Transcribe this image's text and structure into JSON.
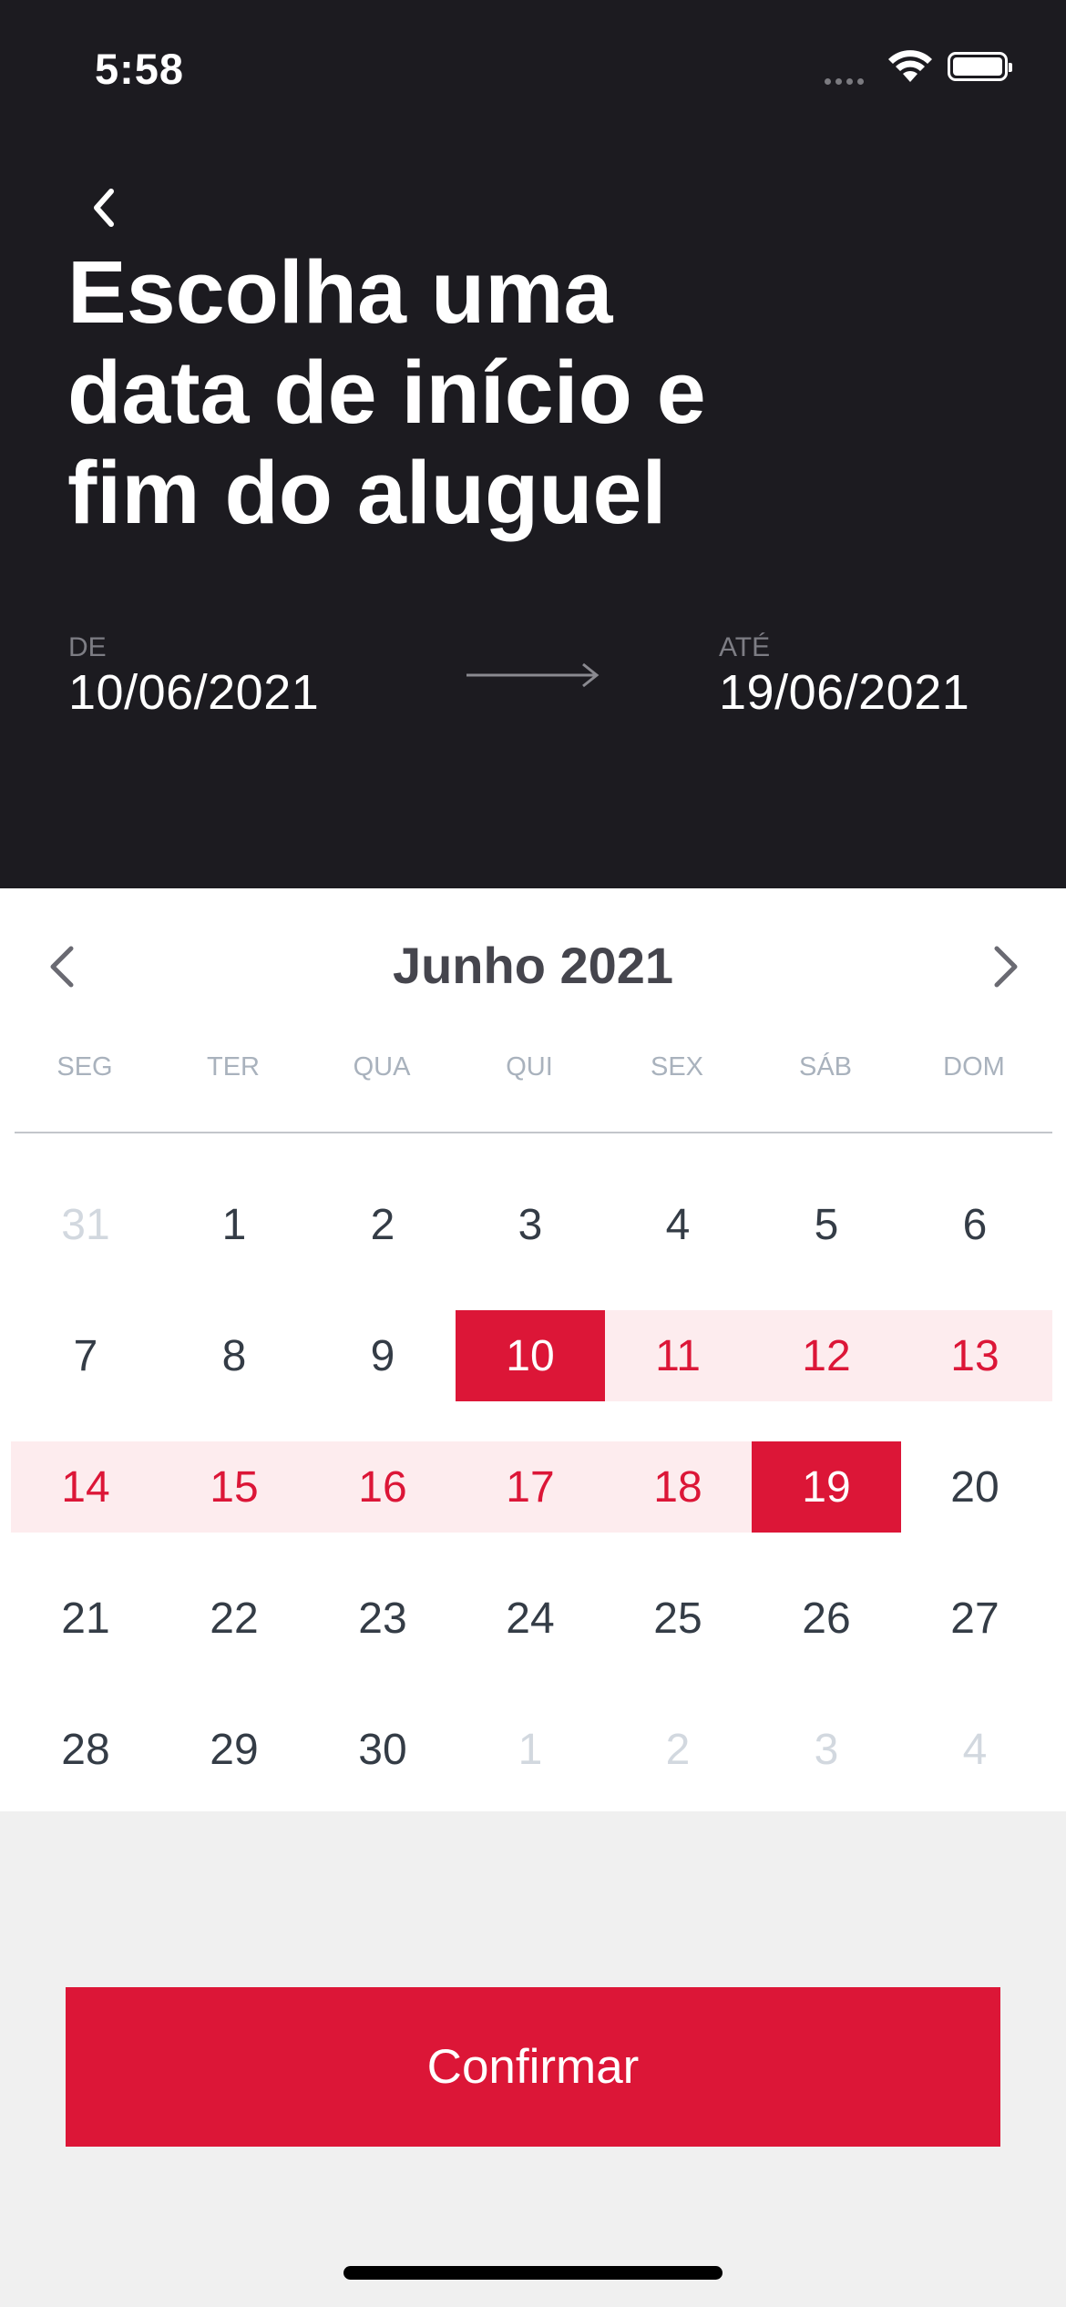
{
  "status_bar": {
    "time": "5:58"
  },
  "header": {
    "title": "Escolha uma data de início e fim do aluguel",
    "start_label": "DE",
    "start_date": "10/06/2021",
    "end_label": "ATÉ",
    "end_date": "19/06/2021"
  },
  "calendar": {
    "month": "Junho 2021",
    "weekdays": [
      "SEG",
      "TER",
      "QUA",
      "QUI",
      "SEX",
      "SÁB",
      "DOM"
    ],
    "weeks": [
      [
        "31",
        "1",
        "2",
        "3",
        "4",
        "5",
        "6"
      ],
      [
        "7",
        "8",
        "9",
        "10",
        "11",
        "12",
        "13"
      ],
      [
        "14",
        "15",
        "16",
        "17",
        "18",
        "19",
        "20"
      ],
      [
        "21",
        "22",
        "23",
        "24",
        "25",
        "26",
        "27"
      ],
      [
        "28",
        "29",
        "30",
        "1",
        "2",
        "3",
        "4"
      ]
    ],
    "selected_start": "10",
    "selected_end": "19"
  },
  "actions": {
    "confirm": "Confirmar"
  },
  "colors": {
    "accent": "#dc1637",
    "range_bg": "#fdecee",
    "header_bg": "#1c1b20"
  },
  "icons": [
    "chevron-left-icon",
    "chevron-right-icon",
    "arrow-right-icon",
    "wifi-icon",
    "battery-icon",
    "signal-icon"
  ]
}
